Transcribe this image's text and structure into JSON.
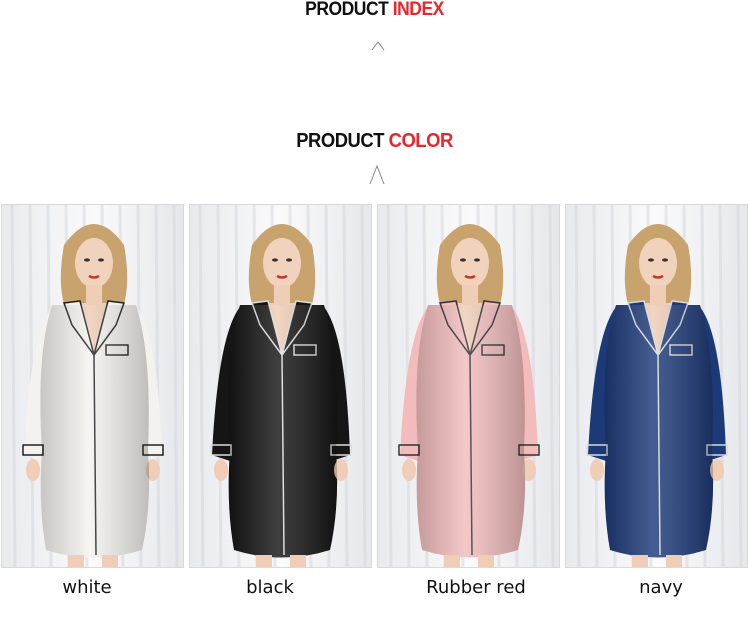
{
  "header": {
    "index_title_part1": "PRODUCT ",
    "index_title_part2": "INDEX",
    "color_title_part1": "PRODUCT ",
    "color_title_part2": "COLOR"
  },
  "colors": {
    "accent": "#e8262b",
    "heading": "#111111"
  },
  "products": [
    {
      "label": "white",
      "shirt_color": "#f4f2ee",
      "piping": "#222222"
    },
    {
      "label": "black",
      "shirt_color": "#151515",
      "piping": "#dddddd"
    },
    {
      "label": "Rubber red",
      "shirt_color": "#f2bcbc",
      "piping": "#333333"
    },
    {
      "label": "navy",
      "shirt_color": "#1d3a78",
      "piping": "#d9d9d9"
    }
  ]
}
